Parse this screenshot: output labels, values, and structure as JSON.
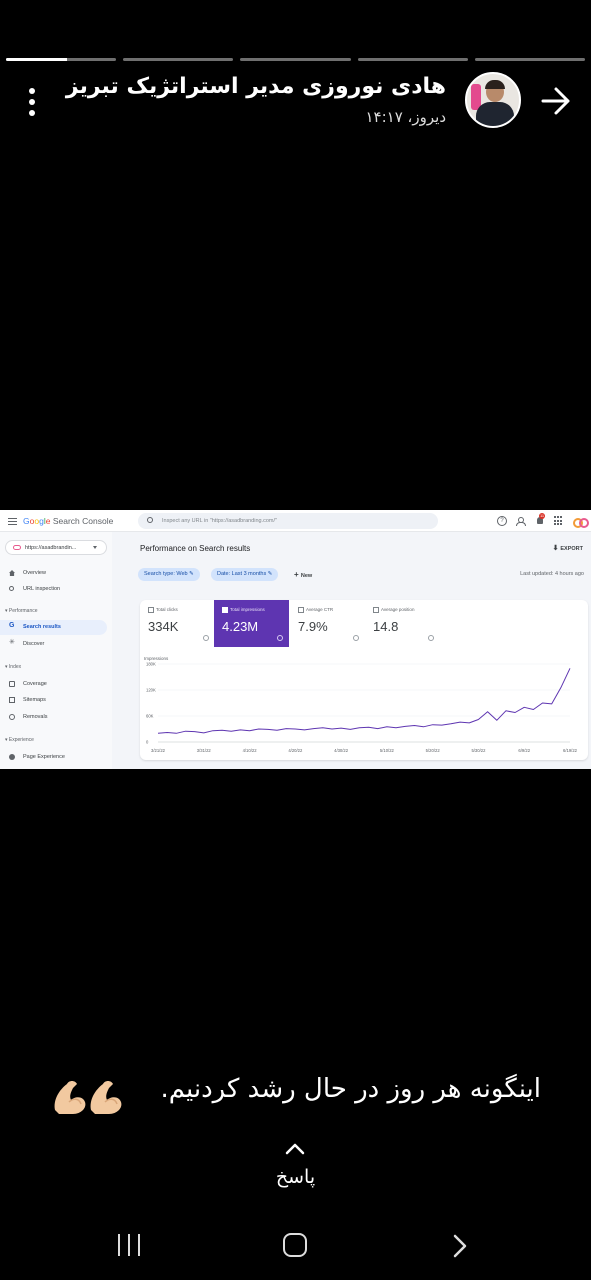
{
  "story": {
    "segments": [
      {
        "progress": 0.55
      },
      {
        "progress": 0
      },
      {
        "progress": 0
      },
      {
        "progress": 0
      },
      {
        "progress": 0
      }
    ],
    "author": "هادی نوروزی مدیر استراتژیک تبریز",
    "time": "دیروز، ۱۴:۱۷",
    "caption": "اینگونه هر روز در حال رشد کردنیم.",
    "caption_emoji": "💪🏻💪🏻",
    "reply_label": "پاسخ"
  },
  "search_console": {
    "logo": {
      "google": "Google",
      "product": "Search Console"
    },
    "search_placeholder": "Inspect any URL in \"https://asadbranding.com/\"",
    "notification_count": "11",
    "property": "https://asadbrandin...",
    "nav": {
      "overview": "Overview",
      "url_inspection": "URL inspection",
      "performance_section": "Performance",
      "search_results": "Search results",
      "discover": "Discover",
      "index_section": "Index",
      "coverage": "Coverage",
      "sitemaps": "Sitemaps",
      "removals": "Removals",
      "experience_section": "Experience",
      "page_experience": "Page Experience"
    },
    "page_title": "Performance on Search results",
    "export_label": "EXPORT",
    "filters": {
      "search_type": "Search type: Web",
      "date": "Date: Last 3 months",
      "new": "New"
    },
    "last_updated": "Last updated: 4 hours ago",
    "metrics": [
      {
        "label": "Total clicks",
        "value": "334K",
        "selected": false
      },
      {
        "label": "Total impressions",
        "value": "4.23M",
        "selected": true
      },
      {
        "label": "Average CTR",
        "value": "7.9%",
        "selected": false
      },
      {
        "label": "Average position",
        "value": "14.8",
        "selected": false
      }
    ],
    "accent_color": "#5e35b1"
  },
  "chart_data": {
    "type": "line",
    "ylabel": "Impressions",
    "ylim": [
      0,
      180000
    ],
    "yticks": [
      {
        "value": 180000,
        "label": "180K"
      },
      {
        "value": 120000,
        "label": "120K"
      },
      {
        "value": 60000,
        "label": "60K"
      },
      {
        "value": 0,
        "label": "0"
      }
    ],
    "xticks": [
      "3/21/22",
      "3/31/22",
      "4/10/22",
      "4/20/22",
      "4/30/22",
      "5/10/22",
      "5/20/22",
      "5/30/22",
      "6/9/22",
      "6/19/22"
    ],
    "series": [
      {
        "color": "#5e35b1",
        "x": [
          "3/21/22",
          "3/23/22",
          "3/25/22",
          "3/27/22",
          "3/29/22",
          "3/31/22",
          "4/2/22",
          "4/4/22",
          "4/6/22",
          "4/8/22",
          "4/10/22",
          "4/12/22",
          "4/14/22",
          "4/16/22",
          "4/18/22",
          "4/20/22",
          "4/22/22",
          "4/24/22",
          "4/26/22",
          "4/28/22",
          "4/30/22",
          "5/2/22",
          "5/4/22",
          "5/6/22",
          "5/8/22",
          "5/10/22",
          "5/12/22",
          "5/14/22",
          "5/16/22",
          "5/18/22",
          "5/20/22",
          "5/22/22",
          "5/24/22",
          "5/26/22",
          "5/28/22",
          "5/30/22",
          "6/1/22",
          "6/3/22",
          "6/5/22",
          "6/7/22",
          "6/9/22",
          "6/11/22",
          "6/13/22",
          "6/15/22",
          "6/17/22",
          "6/19/22"
        ],
        "values": [
          20000,
          22000,
          20000,
          25000,
          24000,
          21000,
          26000,
          27000,
          25000,
          28000,
          26000,
          30000,
          29000,
          27000,
          31000,
          30000,
          28000,
          31000,
          33000,
          30000,
          32000,
          29000,
          33000,
          34000,
          31000,
          35000,
          33000,
          36000,
          38000,
          35000,
          40000,
          39000,
          42000,
          46000,
          44000,
          52000,
          70000,
          50000,
          72000,
          68000,
          80000,
          75000,
          90000,
          88000,
          125000,
          170000
        ]
      }
    ]
  }
}
